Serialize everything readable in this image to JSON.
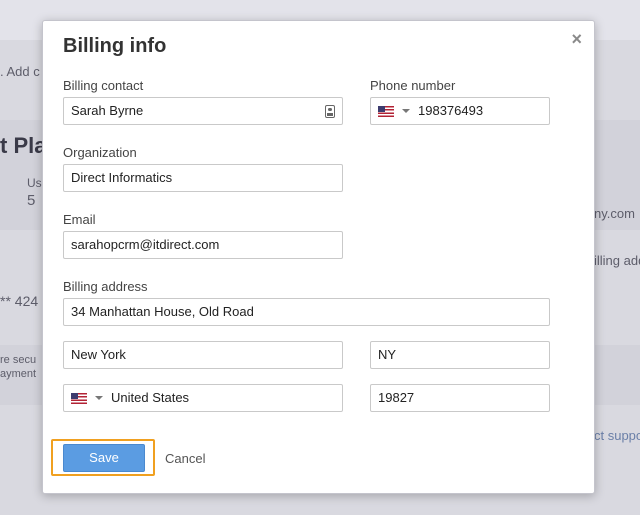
{
  "background": {
    "add_text": ". Add c",
    "plan_heading": "t Pla",
    "us_label": "Us",
    "us_value": "5",
    "domain_fragment": "ny.com",
    "billing_fragment": "illing add",
    "card_fragment": "** 424",
    "secure_line1": "re secu",
    "secure_line2": "ayment",
    "support_fragment": "ct suppo"
  },
  "modal": {
    "title": "Billing info",
    "close_symbol": "×"
  },
  "form": {
    "billing_contact": {
      "label": "Billing contact",
      "value": "Sarah Byrne"
    },
    "phone": {
      "label": "Phone number",
      "value": "198376493",
      "flag_icon": "us-flag-icon"
    },
    "organization": {
      "label": "Organization",
      "value": "Direct Informatics"
    },
    "email": {
      "label": "Email",
      "value": "sarahopcrm@itdirect.com"
    },
    "billing_address": {
      "label": "Billing address",
      "value": "34 Manhattan House, Old Road"
    },
    "city": {
      "value": "New York"
    },
    "state": {
      "value": "NY"
    },
    "country": {
      "value": "United States",
      "flag_icon": "us-flag-icon"
    },
    "zip": {
      "value": "19827"
    }
  },
  "actions": {
    "save_label": "Save",
    "cancel_label": "Cancel"
  },
  "colors": {
    "accent": "#5b9ce2",
    "focus_outline": "#f0a020"
  }
}
